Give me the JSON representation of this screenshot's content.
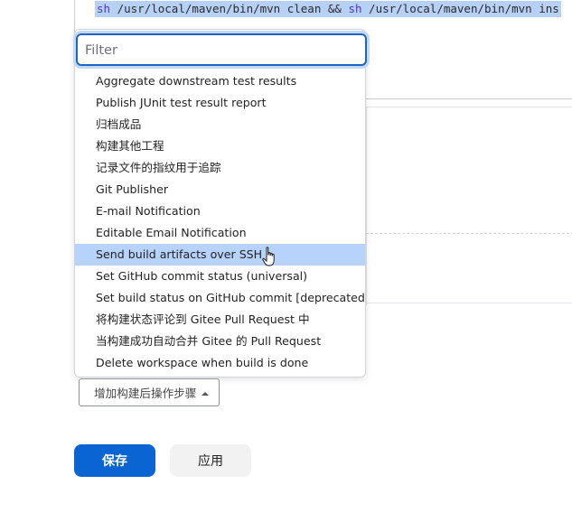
{
  "script": {
    "tokens": [
      {
        "text": "sh",
        "kw": true
      },
      {
        "text": " /usr/local/maven/bin/mvn clean && ",
        "kw": false
      },
      {
        "text": "sh",
        "kw": true
      },
      {
        "text": " /usr/local/maven/bin/mvn ins",
        "kw": false
      }
    ]
  },
  "filter": {
    "placeholder": "Filter",
    "value": ""
  },
  "menu": {
    "items": [
      "Aggregate downstream test results",
      "Publish JUnit test result report",
      "归档成品",
      "构建其他工程",
      "记录文件的指纹用于追踪",
      "Git Publisher",
      "E-mail Notification",
      "Editable Email Notification",
      "Send build artifacts over SSH",
      "Set GitHub commit status (universal)",
      "Set build status on GitHub commit [deprecated]",
      "将构建状态评论到 Gitee Pull Request 中",
      "当构建成功自动合并 Gitee 的 Pull Request",
      "Delete workspace when build is done"
    ],
    "highlighted_index": 8
  },
  "add_step": {
    "label": "增加构建后操作步骤"
  },
  "actions": {
    "save_label": "保存",
    "apply_label": "应用"
  },
  "colors": {
    "primary": "#0a64d1",
    "highlight": "#b7d3fb",
    "focus_ring": "#1f64c3"
  }
}
